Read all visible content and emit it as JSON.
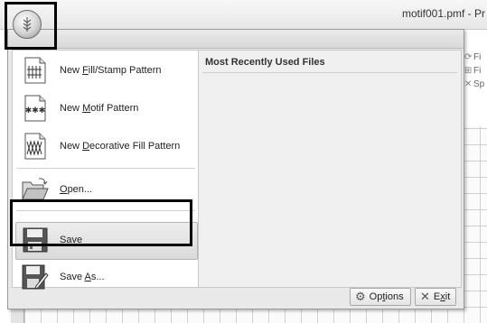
{
  "window": {
    "title": "motif001.pmf - Pr"
  },
  "ribbon_right": {
    "items": [
      {
        "icon": "fill-icon",
        "label": "Fi"
      },
      {
        "icon": "fill-icon",
        "label": "Fi"
      },
      {
        "icon": "sparkle-icon",
        "label": "Sp"
      }
    ]
  },
  "app_menu": {
    "items": [
      {
        "id": "new-fill-stamp",
        "before": "New ",
        "mnemonic": "F",
        "after": "ill/Stamp Pattern",
        "icon": "fill-stamp-pattern-icon"
      },
      {
        "id": "new-motif",
        "before": "New ",
        "mnemonic": "M",
        "after": "otif Pattern",
        "icon": "motif-pattern-icon"
      },
      {
        "id": "new-decorative-fill",
        "before": "New ",
        "mnemonic": "D",
        "after": "ecorative Fill Pattern",
        "icon": "decorative-fill-icon"
      },
      {
        "id": "open",
        "before": "",
        "mnemonic": "O",
        "after": "pen...",
        "icon": "open-folder-icon"
      },
      {
        "id": "save",
        "before": "",
        "mnemonic": "S",
        "after": "ave",
        "icon": "save-icon"
      },
      {
        "id": "save-as",
        "before": "Save ",
        "mnemonic": "A",
        "after": "s...",
        "icon": "save-as-icon"
      }
    ],
    "mru_title": "Most Recently Used Files",
    "options": {
      "before": "Op",
      "mnemonic": "t",
      "after": "ions"
    },
    "exit": {
      "before": "E",
      "mnemonic": "x",
      "after": "it"
    }
  }
}
